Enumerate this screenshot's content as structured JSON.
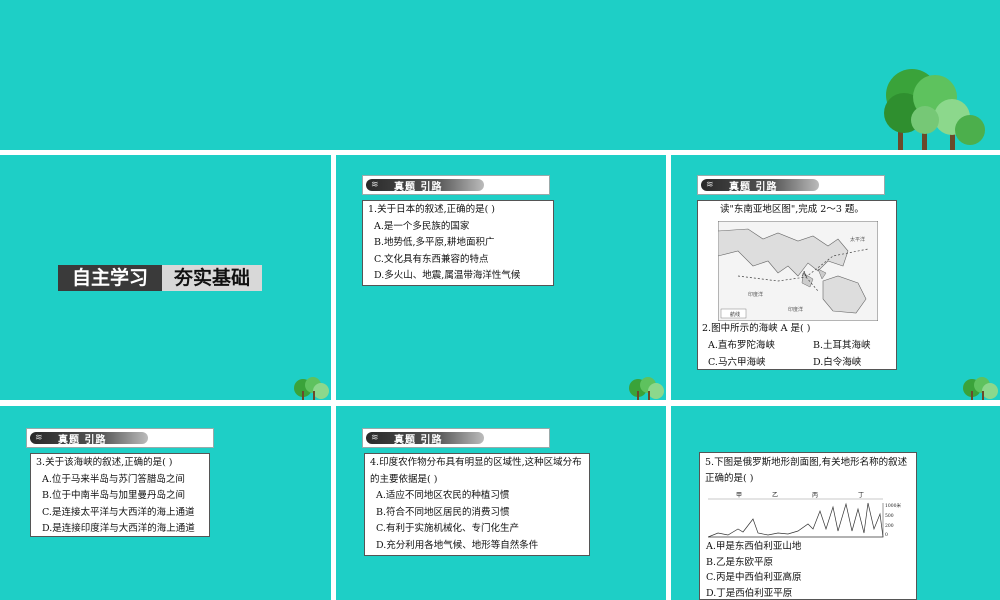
{
  "header_label": "真题 引路",
  "slide1": {
    "banner_left": "自主学习",
    "banner_right": "夯实基础"
  },
  "q1": {
    "stem": "1.关于日本的叙述,正确的是(    )",
    "options": [
      "A.是一个多民族的国家",
      "B.地势低,多平原,耕地面积广",
      "C.文化具有东西兼容的特点",
      "D.多火山、地震,属温带海洋性气候"
    ]
  },
  "map_slide": {
    "intro": "读\"东南亚地区图\",完成 2～3 题。",
    "map_labels": {
      "ocean_west": "印度洋",
      "ocean_south": "印度洋",
      "pacific": "太平洋",
      "legend": "航线"
    },
    "stem": "2.图中所示的海峡 A 是(    )",
    "options": [
      "A.直布罗陀海峡",
      "B.土耳其海峡",
      "C.马六甲海峡",
      "D.白令海峡"
    ]
  },
  "q3": {
    "stem": "3.关于该海峡的叙述,正确的是(    )",
    "options": [
      "A.位于马来半岛与苏门答腊岛之间",
      "B.位于中南半岛与加里曼丹岛之间",
      "C.是连接太平洋与大西洋的海上通道",
      "D.是连接印度洋与大西洋的海上通道"
    ]
  },
  "q4": {
    "stem": "4.印度农作物分布具有明显的区域性,这种区域分布的主要依据是(    )",
    "options": [
      "A.适应不同地区农民的种植习惯",
      "B.符合不同地区居民的消费习惯",
      "C.有利于实施机械化、专门化生产",
      "D.充分利用各地气候、地形等自然条件"
    ]
  },
  "q5": {
    "stem": "5.下图是俄罗斯地形剖面图,有关地形名称的叙述正确的是(    )",
    "profile_labels": [
      "甲",
      "乙",
      "丙",
      "丁"
    ],
    "scale_labels": [
      "1000米",
      "500",
      "200",
      "0"
    ],
    "options": [
      "A.甲是东西伯利亚山地",
      "B.乙是东欧平原",
      "C.丙是中西伯利亚高原",
      "D.丁是西伯利亚平原"
    ]
  }
}
